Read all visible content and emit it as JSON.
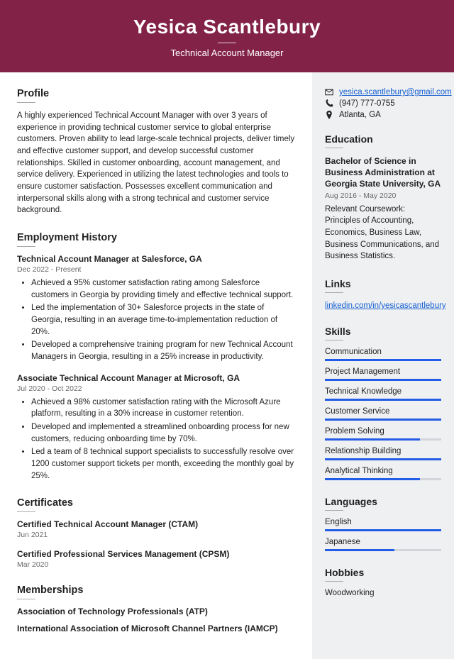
{
  "header": {
    "name": "Yesica Scantlebury",
    "title": "Technical Account Manager"
  },
  "profile": {
    "heading": "Profile",
    "text": "A highly experienced Technical Account Manager with over 3 years of experience in providing technical customer service to global enterprise customers. Proven ability to lead large-scale technical projects, deliver timely and effective customer support, and develop successful customer relationships. Skilled in customer onboarding, account management, and service delivery. Experienced in utilizing the latest technologies and tools to ensure customer satisfaction. Possesses excellent communication and interpersonal skills along with a strong technical and customer service background."
  },
  "employment": {
    "heading": "Employment History",
    "jobs": [
      {
        "title": "Technical Account Manager at Salesforce, GA",
        "dates": "Dec 2022 - Present",
        "bullets": [
          "Achieved a 95% customer satisfaction rating among Salesforce customers in Georgia by providing timely and effective technical support.",
          "Led the implementation of 30+ Salesforce projects in the state of Georgia, resulting in an average time-to-implementation reduction of 20%.",
          "Developed a comprehensive training program for new Technical Account Managers in Georgia, resulting in a 25% increase in productivity."
        ]
      },
      {
        "title": "Associate Technical Account Manager at Microsoft, GA",
        "dates": "Jul 2020 - Oct 2022",
        "bullets": [
          "Achieved a 98% customer satisfaction rating with the Microsoft Azure platform, resulting in a 30% increase in customer retention.",
          "Developed and implemented a streamlined onboarding process for new customers, reducing onboarding time by 70%.",
          "Led a team of 8 technical support specialists to successfully resolve over 1200 customer support tickets per month, exceeding the monthly goal by 25%."
        ]
      }
    ]
  },
  "certificates": {
    "heading": "Certificates",
    "items": [
      {
        "title": "Certified Technical Account Manager (CTAM)",
        "date": "Jun 2021"
      },
      {
        "title": "Certified Professional Services Management (CPSM)",
        "date": "Mar 2020"
      }
    ]
  },
  "memberships": {
    "heading": "Memberships",
    "items": [
      "Association of Technology Professionals (ATP)",
      "International Association of Microsoft Channel Partners (IAMCP)"
    ]
  },
  "contact": {
    "email": "yesica.scantlebury@gmail.com",
    "phone": "(947) 777-0755",
    "location": "Atlanta, GA"
  },
  "education": {
    "heading": "Education",
    "degree": "Bachelor of Science in Business Administration at Georgia State University, GA",
    "dates": "Aug 2016 - May 2020",
    "detail": "Relevant Coursework: Principles of Accounting, Economics, Business Law, Business Communications, and Business Statistics."
  },
  "links": {
    "heading": "Links",
    "items": [
      "linkedin.com/in/yesicascantlebury"
    ]
  },
  "skills": {
    "heading": "Skills",
    "items": [
      {
        "name": "Communication",
        "level": 100
      },
      {
        "name": "Project Management",
        "level": 100
      },
      {
        "name": "Technical Knowledge",
        "level": 100
      },
      {
        "name": "Customer Service",
        "level": 100
      },
      {
        "name": "Problem Solving",
        "level": 82
      },
      {
        "name": "Relationship Building",
        "level": 100
      },
      {
        "name": "Analytical Thinking",
        "level": 82
      }
    ]
  },
  "languages": {
    "heading": "Languages",
    "items": [
      {
        "name": "English",
        "level": 100
      },
      {
        "name": "Japanese",
        "level": 60
      }
    ]
  },
  "hobbies": {
    "heading": "Hobbies",
    "items": [
      "Woodworking"
    ]
  }
}
